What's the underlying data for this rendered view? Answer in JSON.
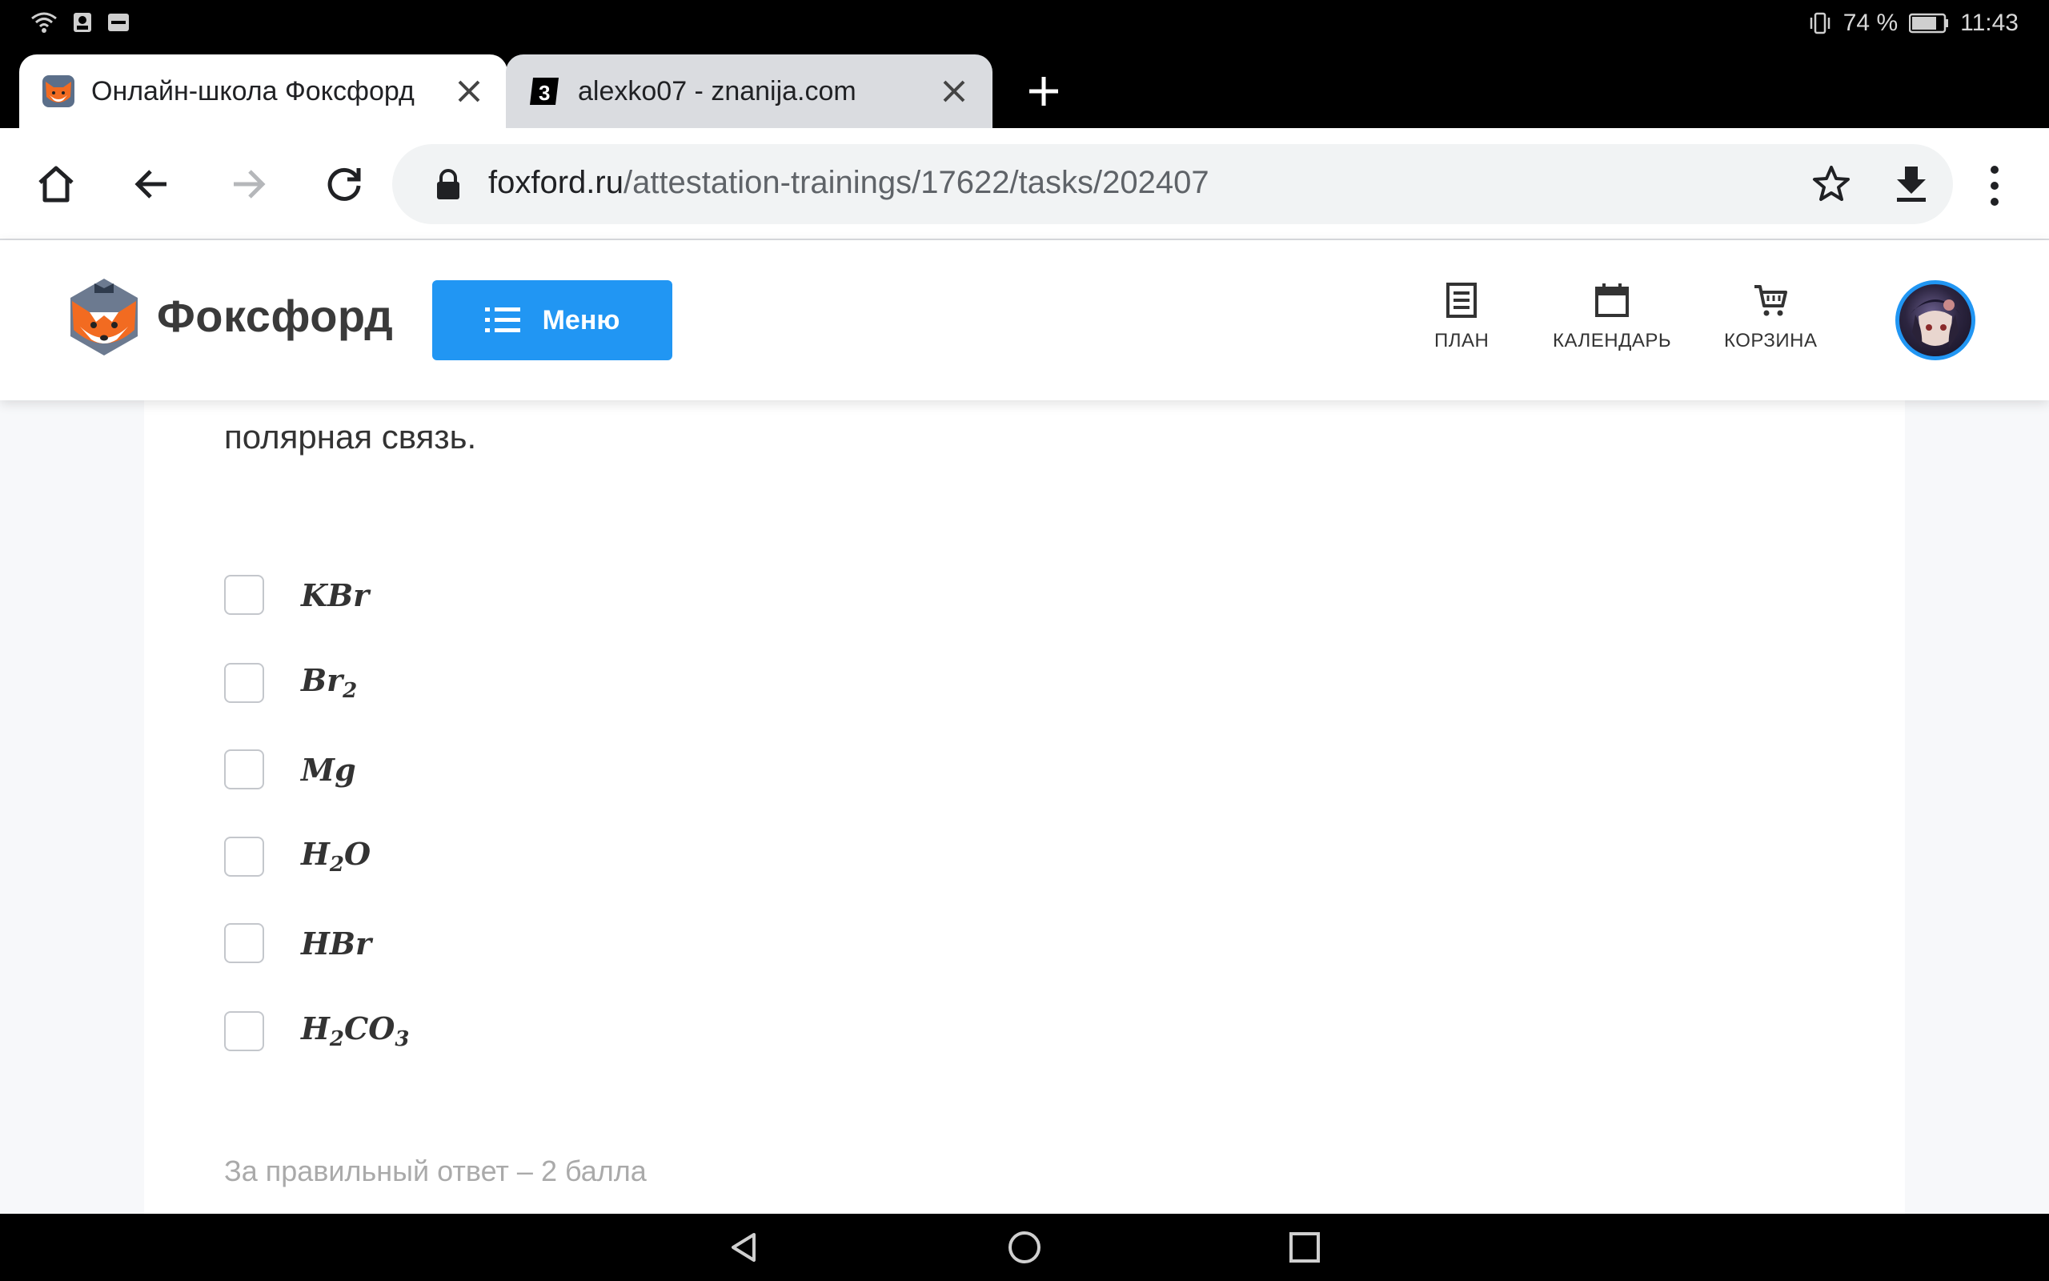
{
  "status_bar": {
    "battery": "74 %",
    "time": "11:43"
  },
  "tabs": [
    {
      "title": "Онлайн-школа Фоксфорд",
      "active": true,
      "favicon": "fox-favicon"
    },
    {
      "title": "alexko07 - znanija.com",
      "active": false,
      "favicon": "znanija-favicon"
    }
  ],
  "address_bar": {
    "url_host": "foxford.ru",
    "url_path": "/attestation-trainings/17622/tasks/202407"
  },
  "site_header": {
    "logo_text": "Фоксфорд",
    "menu_label": "Меню",
    "nav": [
      {
        "label": "ПЛАН",
        "icon": "plan-icon"
      },
      {
        "label": "КАЛЕНДАРЬ",
        "icon": "calendar-icon"
      },
      {
        "label": "КОРЗИНА",
        "icon": "cart-icon"
      }
    ]
  },
  "task": {
    "question_tail": "полярная связь.",
    "options": [
      {
        "parts": [
          [
            "KBr",
            ""
          ]
        ]
      },
      {
        "parts": [
          [
            "Br",
            "2"
          ]
        ]
      },
      {
        "parts": [
          [
            "Mg",
            ""
          ]
        ]
      },
      {
        "parts": [
          [
            "H",
            "2"
          ],
          [
            "O",
            ""
          ]
        ]
      },
      {
        "parts": [
          [
            "HBr",
            ""
          ]
        ]
      },
      {
        "parts": [
          [
            "H",
            "2"
          ],
          [
            "CO",
            "3"
          ]
        ]
      }
    ],
    "points_note": "За правильный ответ – 2 балла"
  },
  "colors": {
    "accent": "#2196f3",
    "fox_orange": "#f26b21"
  }
}
